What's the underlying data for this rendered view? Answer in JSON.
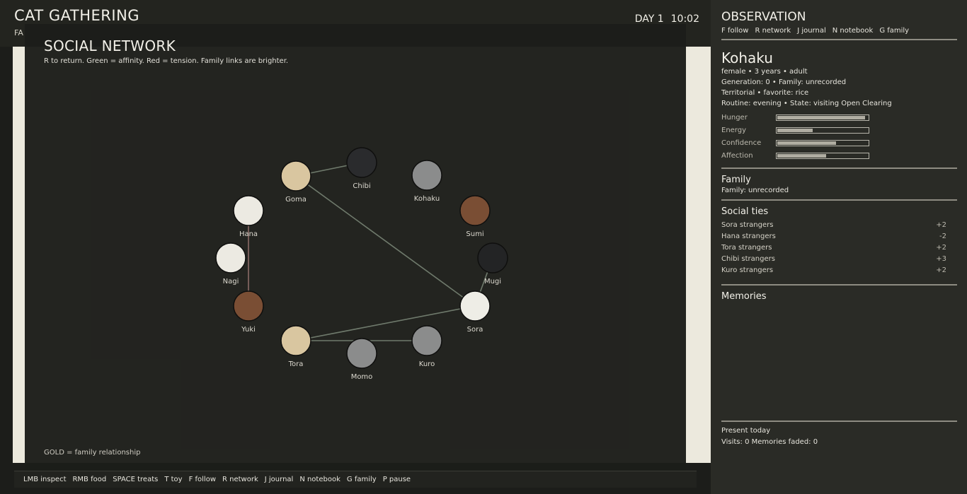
{
  "header": {
    "title": "CAT GATHERING",
    "subtitle": "FA",
    "day": "DAY 1",
    "time": "10:02"
  },
  "network": {
    "title": "SOCIAL NETWORK",
    "hint": "R to return. Green = affinity. Red = tension. Family links are brighter.",
    "legend": "GOLD = family relationship",
    "nodes": [
      {
        "id": "goma",
        "name": "Goma",
        "color": "#d9c6a0"
      },
      {
        "id": "chibi",
        "name": "Chibi",
        "color": "#2a2b2d"
      },
      {
        "id": "kohaku",
        "name": "Kohaku",
        "color": "#8b8c8c"
      },
      {
        "id": "hana",
        "name": "Hana",
        "color": "#eceae2"
      },
      {
        "id": "sumi",
        "name": "Sumi",
        "color": "#7a4e34"
      },
      {
        "id": "nagi",
        "name": "Nagi",
        "color": "#eceae2"
      },
      {
        "id": "mugi",
        "name": "Mugi",
        "color": "#232425"
      },
      {
        "id": "yuki",
        "name": "Yuki",
        "color": "#7a4e34"
      },
      {
        "id": "sora",
        "name": "Sora",
        "color": "#eeede6"
      },
      {
        "id": "tora",
        "name": "Tora",
        "color": "#d9c6a0"
      },
      {
        "id": "kuro",
        "name": "Kuro",
        "color": "#8b8c8c"
      },
      {
        "id": "momo",
        "name": "Momo",
        "color": "#8b8c8c"
      }
    ],
    "links": [
      {
        "a": "goma",
        "b": "chibi",
        "kind": "affinity"
      },
      {
        "a": "goma",
        "b": "sora",
        "kind": "affinity"
      },
      {
        "a": "hana",
        "b": "yuki",
        "kind": "tension"
      },
      {
        "a": "mugi",
        "b": "sora",
        "kind": "affinity"
      },
      {
        "a": "tora",
        "b": "sora",
        "kind": "affinity"
      },
      {
        "a": "tora",
        "b": "kuro",
        "kind": "affinity"
      }
    ],
    "colors": {
      "affinity": "#6f7a6c",
      "tension": "#8a6a66",
      "family": "#c9a84a"
    }
  },
  "controls": [
    "LMB inspect",
    "RMB food",
    "SPACE treats",
    "T toy",
    "F follow",
    "R network",
    "J journal",
    "N notebook",
    "G family",
    "P pause"
  ],
  "panel": {
    "title": "OBSERVATION",
    "keys": [
      "F follow",
      "R network",
      "J journal",
      "N notebook",
      "G family"
    ],
    "cat": {
      "name": "Kohaku",
      "line1": "female  •  3 years  •  adult",
      "line2": "Generation: 0  •  Family: unrecorded",
      "line3": "Territorial  •  favorite: rice",
      "line4": "Routine: evening  •  State: visiting Open Clearing"
    },
    "stats": [
      {
        "label": "Hunger",
        "value": 0.97
      },
      {
        "label": "Energy",
        "value": 0.39
      },
      {
        "label": "Confidence",
        "value": 0.65
      },
      {
        "label": "Affection",
        "value": 0.54
      }
    ],
    "family": {
      "title": "Family",
      "text": "Family: unrecorded"
    },
    "ties": {
      "title": "Social ties",
      "rows": [
        {
          "name": "Sora  strangers",
          "value": "+2"
        },
        {
          "name": "Hana  strangers",
          "value": "-2"
        },
        {
          "name": "Tora  strangers",
          "value": "+2"
        },
        {
          "name": "Chibi  strangers",
          "value": "+3"
        },
        {
          "name": "Kuro  strangers",
          "value": "+2"
        }
      ]
    },
    "memories": {
      "title": "Memories"
    },
    "footer": {
      "title": "Present today",
      "text": "Visits: 0  Memories faded: 0"
    }
  }
}
